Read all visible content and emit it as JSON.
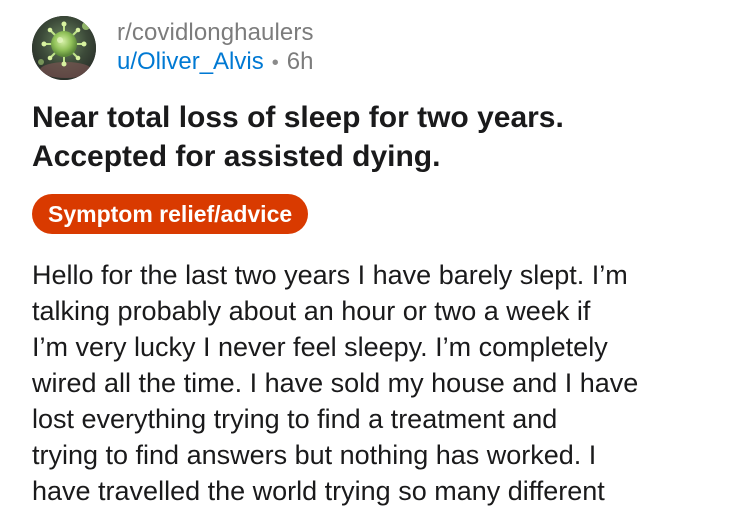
{
  "post": {
    "subreddit": "r/covidlonghaulers",
    "author": "u/Oliver_Alvis",
    "separator": "•",
    "age": "6h",
    "avatar_icon": "coronavirus-avatar-icon",
    "title_lines": [
      "Near total loss of sleep for two years.",
      "Accepted for assisted dying."
    ],
    "flair": "Symptom relief/advice",
    "flair_color": "#d93a00",
    "body_lines": [
      "Hello for the last two years I have barely slept. I’m",
      "talking probably about an hour or two a week if",
      "I’m very lucky I never feel sleepy.  I’m completely",
      "wired all the time. I have sold my house and I have",
      "lost everything trying to find a treatment and",
      "trying to find answers but nothing has worked. I",
      "have travelled the world trying so many different"
    ]
  }
}
